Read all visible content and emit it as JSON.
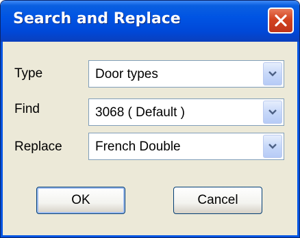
{
  "dialog": {
    "title": "Search and Replace",
    "close_icon": "close-icon"
  },
  "fields": {
    "type": {
      "label": "Type",
      "value": "Door types"
    },
    "find": {
      "label": "Find",
      "value": "3068 ( Default )"
    },
    "replace": {
      "label": "Replace",
      "value": "French Double"
    }
  },
  "buttons": {
    "ok_label": "OK",
    "cancel_label": "Cancel"
  },
  "colors": {
    "titlebar": "#0054e3",
    "close_button": "#d2431f",
    "dialog_background": "#ece9d8",
    "combo_border": "#7f9db9"
  }
}
